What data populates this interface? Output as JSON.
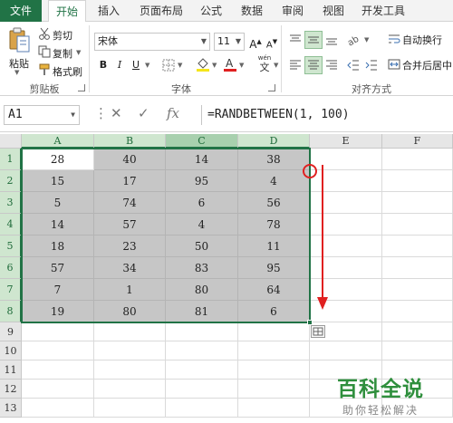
{
  "ribbon_tabs": [
    "文件",
    "开始",
    "插入",
    "页面布局",
    "公式",
    "数据",
    "审阅",
    "视图",
    "开发工具"
  ],
  "active_tab": "开始",
  "clipboard": {
    "paste": "粘贴",
    "cut": "剪切",
    "copy": "复制",
    "format_painter": "格式刷",
    "group": "剪贴板"
  },
  "font": {
    "name": "宋体",
    "size": "11",
    "bold": "B",
    "italic": "I",
    "underline": "U",
    "grow": "A",
    "shrink": "A",
    "group": "字体",
    "wen": "wén",
    "wen_char": "文"
  },
  "alignment": {
    "wrap_text": "自动换行",
    "merge_center": "合并后居中",
    "group": "对齐方式"
  },
  "name_box": "A1",
  "formula": "=RANDBETWEEN(1, 100)",
  "fx": "fx",
  "columns": [
    "A",
    "B",
    "C",
    "D",
    "E",
    "F"
  ],
  "rows": [
    "1",
    "2",
    "3",
    "4",
    "5",
    "6",
    "7",
    "8",
    "9",
    "10",
    "11",
    "12",
    "13"
  ],
  "cells": [
    [
      "28",
      "40",
      "14",
      "38"
    ],
    [
      "15",
      "17",
      "95",
      "4"
    ],
    [
      "5",
      "74",
      "6",
      "56"
    ],
    [
      "14",
      "57",
      "4",
      "78"
    ],
    [
      "18",
      "23",
      "50",
      "11"
    ],
    [
      "57",
      "34",
      "83",
      "95"
    ],
    [
      "7",
      "1",
      "80",
      "64"
    ],
    [
      "19",
      "80",
      "81",
      "6"
    ]
  ],
  "watermark": {
    "title": "百科全说",
    "subtitle": "助你轻松解决"
  },
  "colors": {
    "excel_green": "#217346",
    "annotation_red": "#e02020",
    "selection_fill": "#c6c6c6"
  }
}
